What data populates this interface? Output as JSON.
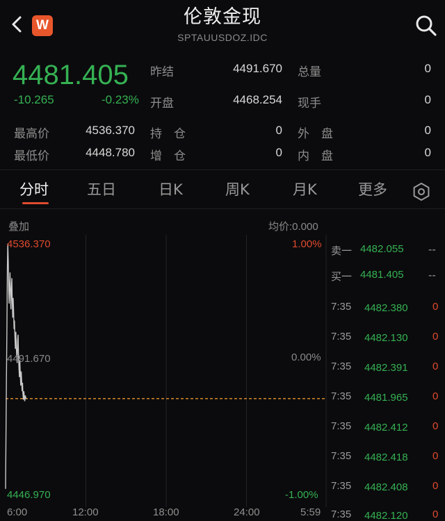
{
  "header": {
    "title": "伦敦金现",
    "subtitle": "SPTAUUSDOZ.IDC",
    "app_logo_letter": "W",
    "back_icon": "chevron-left-icon",
    "search_icon": "search-icon"
  },
  "quote": {
    "last_price": "4481.405",
    "change": "-10.265",
    "change_pct": "-0.23%",
    "prev_close_label": "昨结",
    "prev_close": "4491.670",
    "open_label": "开盘",
    "open": "4468.254",
    "total_volume_label": "总量",
    "total_volume": "0",
    "current_hand_label": "现手",
    "current_hand": "0",
    "high_label": "最高价",
    "high": "4536.370",
    "low_label": "最低价",
    "low": "4448.780",
    "open_interest_label": "持　仓",
    "open_interest": "0",
    "oi_change_label": "增　仓",
    "oi_change": "0",
    "outer_label": "外　盘",
    "outer": "0",
    "inner_label": "内　盘",
    "inner": "0"
  },
  "tabs": [
    {
      "label": "分时",
      "active": true
    },
    {
      "label": "五日",
      "active": false
    },
    {
      "label": "日K",
      "active": false
    },
    {
      "label": "周K",
      "active": false
    },
    {
      "label": "月K",
      "active": false
    },
    {
      "label": "更多",
      "active": false
    }
  ],
  "settings_icon": "gear-icon",
  "chart_header": {
    "overlay_label": "叠加",
    "avg_price_label": "均价:0.000"
  },
  "chart_data": {
    "type": "line",
    "title": "",
    "xlabel": "",
    "ylabel": "",
    "y_tick_labels": {
      "top": "4536.370",
      "mid": "4491.670",
      "bottom": "4446.970",
      "top_pct": "1.00%",
      "mid_pct": "0.00%",
      "bottom_pct": "-1.00%"
    },
    "x_tick_labels": [
      "6:00",
      "12:00",
      "18:00",
      "24:00",
      "5:59"
    ],
    "ylim": [
      4446.97,
      4536.37
    ],
    "x_range_minutes": [
      0,
      1439
    ],
    "reference_line": 4481.405,
    "series": [
      {
        "x": [
          0,
          2,
          4,
          6,
          8,
          10,
          12,
          14,
          16,
          18,
          20,
          22,
          24,
          26,
          28,
          30,
          32,
          34,
          36,
          38,
          40,
          42,
          44,
          46,
          48,
          50,
          52,
          54,
          56,
          58,
          60,
          62,
          64,
          66,
          68,
          70,
          72,
          74,
          76,
          78,
          80,
          82,
          84,
          86,
          88,
          90,
          92,
          94
        ],
        "values": [
          4449.5,
          4468.3,
          4490.0,
          4505.0,
          4528.0,
          4536.2,
          4530.0,
          4520.0,
          4515.0,
          4522.0,
          4526.0,
          4518.0,
          4513.0,
          4520.0,
          4524.0,
          4516.0,
          4510.0,
          4517.0,
          4512.0,
          4506.0,
          4509.0,
          4503.0,
          4499.0,
          4505.0,
          4500.0,
          4496.0,
          4494.0,
          4502.0,
          4504.0,
          4497.0,
          4492.0,
          4489.0,
          4495.0,
          4490.0,
          4486.0,
          4491.0,
          4488.0,
          4484.0,
          4487.0,
          4483.0,
          4481.0,
          4484.0,
          4482.0,
          4480.5,
          4482.5,
          4481.9,
          4481.4,
          4481.4
        ]
      }
    ]
  },
  "order_book": {
    "ask_label": "卖一",
    "ask_price": "4482.055",
    "ask_vol": "--",
    "bid_label": "买一",
    "bid_price": "4481.405",
    "bid_vol": "--"
  },
  "trades": [
    {
      "time": "7:35",
      "price": "4482.380",
      "vol": "0"
    },
    {
      "time": "7:35",
      "price": "4482.130",
      "vol": "0"
    },
    {
      "time": "7:35",
      "price": "4482.391",
      "vol": "0"
    },
    {
      "time": "7:35",
      "price": "4481.965",
      "vol": "0"
    },
    {
      "time": "7:35",
      "price": "4482.412",
      "vol": "0"
    },
    {
      "time": "7:35",
      "price": "4482.418",
      "vol": "0"
    },
    {
      "time": "7:35",
      "price": "4482.408",
      "vol": "0"
    },
    {
      "time": "7:35",
      "price": "4482.120",
      "vol": "0"
    }
  ],
  "colors": {
    "up": "#e04a2e",
    "down": "#35b153",
    "reference": "#e8952e",
    "grid": "#242428",
    "price_line": "#c9c9c9"
  }
}
